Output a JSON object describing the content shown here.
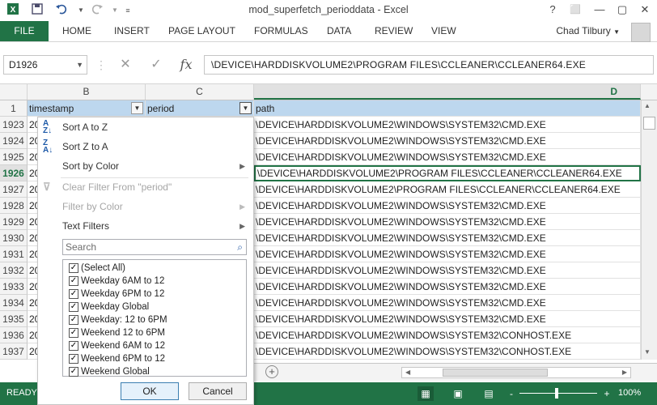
{
  "window": {
    "title": "mod_superfetch_perioddata - Excel",
    "help": "?",
    "restore": "⬜",
    "minimize": "—",
    "maximize": "▢",
    "close": "✕"
  },
  "ribbon": {
    "file": "FILE",
    "tabs": [
      "HOME",
      "INSERT",
      "PAGE LAYOUT",
      "FORMULAS",
      "DATA",
      "REVIEW",
      "VIEW"
    ],
    "user": "Chad Tilbury"
  },
  "formula_bar": {
    "name_box": "D1926",
    "formula": "\\DEVICE\\HARDDISKVOLUME2\\PROGRAM FILES\\CCLEANER\\CCLEANER64.EXE",
    "fx": "fx"
  },
  "columns": [
    "B",
    "C",
    "D"
  ],
  "header_row": {
    "num": "1",
    "timestamp": "timestamp",
    "period": "period",
    "path": "path"
  },
  "rows": [
    {
      "num": "1923",
      "ts": "20",
      "path": "\\DEVICE\\HARDDISKVOLUME2\\WINDOWS\\SYSTEM32\\CMD.EXE"
    },
    {
      "num": "1924",
      "ts": "20",
      "path": "\\DEVICE\\HARDDISKVOLUME2\\WINDOWS\\SYSTEM32\\CMD.EXE"
    },
    {
      "num": "1925",
      "ts": "20",
      "path": "\\DEVICE\\HARDDISKVOLUME2\\WINDOWS\\SYSTEM32\\CMD.EXE"
    },
    {
      "num": "1926",
      "ts": "20",
      "path": "\\DEVICE\\HARDDISKVOLUME2\\PROGRAM FILES\\CCLEANER\\CCLEANER64.EXE"
    },
    {
      "num": "1927",
      "ts": "20",
      "path": "\\DEVICE\\HARDDISKVOLUME2\\PROGRAM FILES\\CCLEANER\\CCLEANER64.EXE"
    },
    {
      "num": "1928",
      "ts": "20",
      "path": "\\DEVICE\\HARDDISKVOLUME2\\WINDOWS\\SYSTEM32\\CMD.EXE"
    },
    {
      "num": "1929",
      "ts": "20",
      "path": "\\DEVICE\\HARDDISKVOLUME2\\WINDOWS\\SYSTEM32\\CMD.EXE"
    },
    {
      "num": "1930",
      "ts": "20",
      "path": "\\DEVICE\\HARDDISKVOLUME2\\WINDOWS\\SYSTEM32\\CMD.EXE"
    },
    {
      "num": "1931",
      "ts": "20",
      "path": "\\DEVICE\\HARDDISKVOLUME2\\WINDOWS\\SYSTEM32\\CMD.EXE"
    },
    {
      "num": "1932",
      "ts": "20",
      "path": "\\DEVICE\\HARDDISKVOLUME2\\WINDOWS\\SYSTEM32\\CMD.EXE"
    },
    {
      "num": "1933",
      "ts": "20",
      "path": "\\DEVICE\\HARDDISKVOLUME2\\WINDOWS\\SYSTEM32\\CMD.EXE"
    },
    {
      "num": "1934",
      "ts": "20",
      "path": "\\DEVICE\\HARDDISKVOLUME2\\WINDOWS\\SYSTEM32\\CMD.EXE"
    },
    {
      "num": "1935",
      "ts": "20",
      "path": "\\DEVICE\\HARDDISKVOLUME2\\WINDOWS\\SYSTEM32\\CMD.EXE"
    },
    {
      "num": "1936",
      "ts": "20",
      "path": "\\DEVICE\\HARDDISKVOLUME2\\WINDOWS\\SYSTEM32\\CONHOST.EXE"
    },
    {
      "num": "1937",
      "ts": "20",
      "path": "\\DEVICE\\HARDDISKVOLUME2\\WINDOWS\\SYSTEM32\\CONHOST.EXE"
    }
  ],
  "filter_menu": {
    "sort_az": "Sort A to Z",
    "sort_za": "Sort Z to A",
    "sort_by_color": "Sort by Color",
    "clear_filter": "Clear Filter From \"period\"",
    "filter_by_color": "Filter by Color",
    "text_filters": "Text Filters",
    "search_placeholder": "Search",
    "items": [
      "(Select All)",
      "Weekday 6AM to 12",
      "Weekday 6PM to 12",
      "Weekday Global",
      "Weekday: 12 to 6PM",
      "Weekend 12 to 6PM",
      "Weekend 6AM to 12",
      "Weekend 6PM to 12",
      "Weekend Global"
    ],
    "ok": "OK",
    "cancel": "Cancel"
  },
  "status_bar": {
    "ready": "READY",
    "zoom": "100%",
    "zoom_minus": "-",
    "zoom_plus": "+"
  },
  "colors": {
    "excel_green": "#217346",
    "header_fill": "#bdd7ee",
    "selected_row": "#217346"
  }
}
